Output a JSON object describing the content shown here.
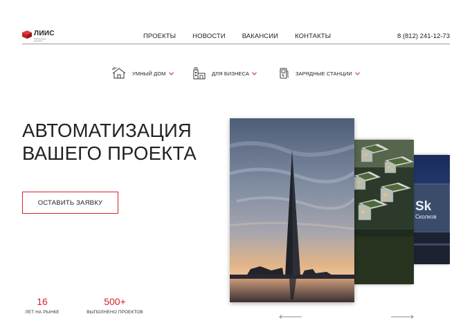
{
  "header": {
    "logo_text": "ЛИИС",
    "logo_subtitle": "Инженерные решения",
    "nav": [
      "ПРОЕКТЫ",
      "НОВОСТИ",
      "ВАКАНСИИ",
      "КОНТАКТЫ"
    ],
    "phone": "8 (812) 241-12-73"
  },
  "subnav": [
    {
      "label": "УМНЫЙ ДОМ",
      "icon": "smart-home-icon"
    },
    {
      "label": "ДЛЯ БИЗНЕСА",
      "icon": "business-building-icon"
    },
    {
      "label": "ЗАРЯДНЫЕ СТАНЦИИ",
      "icon": "charging-station-icon"
    }
  ],
  "hero": {
    "title_line1": "АВТОМАТИЗАЦИЯ",
    "title_line2": "ВАШЕГО ПРОЕКТА",
    "cta_label": "ОСТАВИТЬ ЗАЯВКУ"
  },
  "stats": [
    {
      "value": "16",
      "label": "ЛЕТ НА РЫНКЕ"
    },
    {
      "value": "500+",
      "label": "ВЫПОЛНЕНО ПРОЕКТОВ"
    }
  ],
  "slides": {
    "back2_logo": "Sk",
    "back2_caption": "Сколков"
  },
  "colors": {
    "accent": "#d4232b",
    "text": "#222222",
    "divider": "#9a9a9a"
  }
}
